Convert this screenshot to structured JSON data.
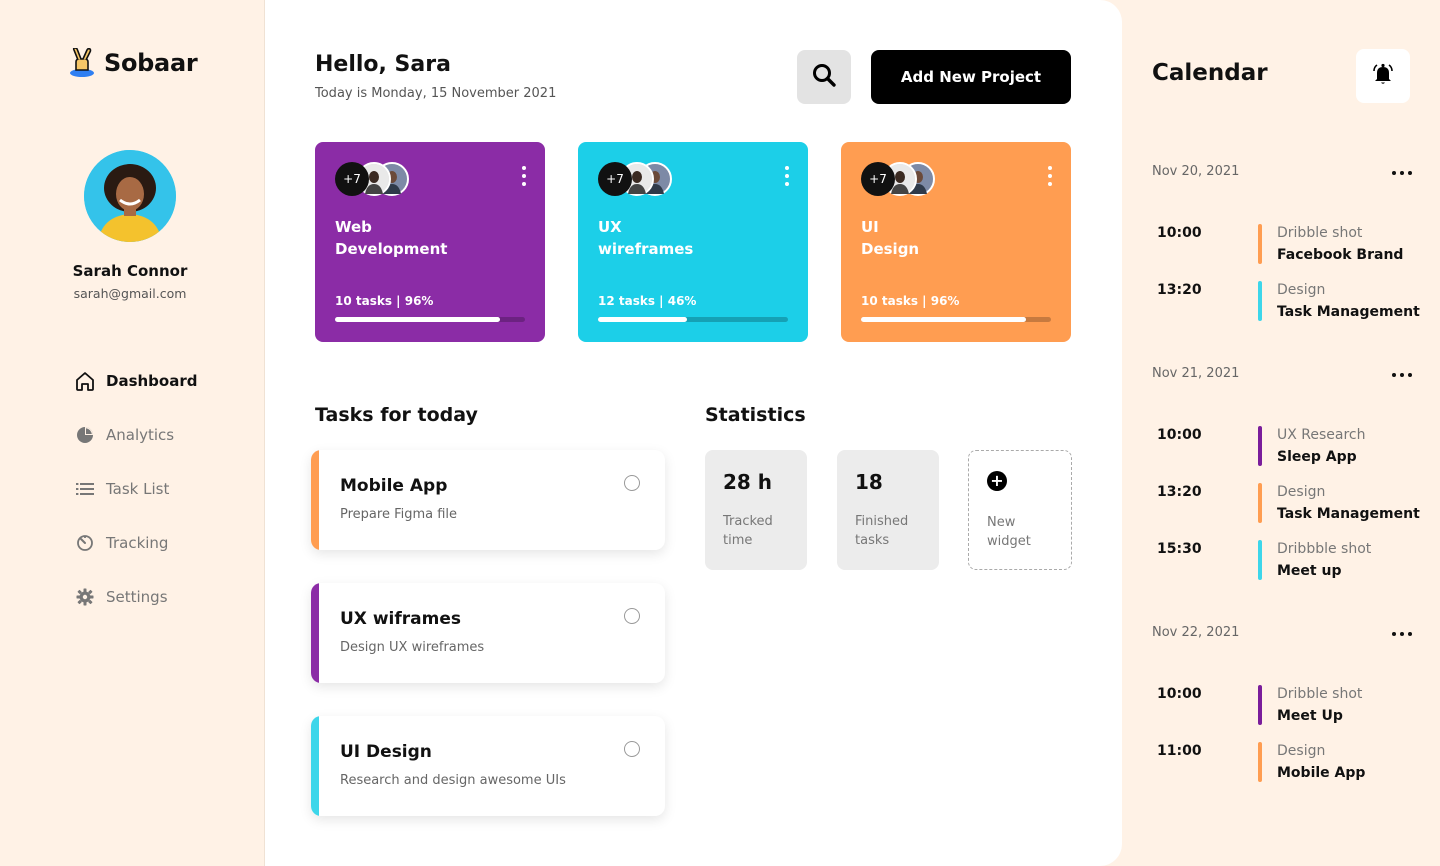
{
  "sidebar": {
    "brand": "Sobaar",
    "profile": {
      "name": "Sarah Connor",
      "email": "sarah@gmail.com"
    },
    "nav": [
      {
        "label": "Dashboard",
        "icon": "home-icon",
        "active": true
      },
      {
        "label": "Analytics",
        "icon": "pie-chart-icon",
        "active": false
      },
      {
        "label": "Task List",
        "icon": "list-icon",
        "active": false
      },
      {
        "label": "Tracking",
        "icon": "timer-icon",
        "active": false
      },
      {
        "label": "Settings",
        "icon": "gear-icon",
        "active": false
      }
    ]
  },
  "header": {
    "greeting": "Hello, Sara",
    "date_line": "Today is Monday, 15 November 2021",
    "add_button": "Add New Project",
    "search_icon": "search-icon"
  },
  "projects": [
    {
      "title_line1": "Web",
      "title_line2": "Development",
      "stats": "10 tasks | 96%",
      "progress": 0.87,
      "members_extra": "+7",
      "color": "#8b2ca6"
    },
    {
      "title_line1": "UX",
      "title_line2": "wireframes",
      "stats": "12 tasks | 46%",
      "progress": 0.47,
      "members_extra": "+7",
      "color": "#1ccfe8"
    },
    {
      "title_line1": "UI",
      "title_line2": "Design",
      "stats": "10 tasks | 96%",
      "progress": 0.87,
      "members_extra": "+7",
      "color": "#ff9d51"
    }
  ],
  "tasks": {
    "title": "Tasks for today",
    "items": [
      {
        "title": "Mobile App",
        "subtitle": "Prepare Figma file",
        "color": "#ff9d51"
      },
      {
        "title": "UX wiframes",
        "subtitle": "Design UX wireframes",
        "color": "#8b2ca6"
      },
      {
        "title": "UI Design",
        "subtitle": "Research and design awesome UIs",
        "color": "#3dd6ea"
      }
    ]
  },
  "statistics": {
    "title": "Statistics",
    "tracked": {
      "value": "28 h",
      "label_line1": "Tracked",
      "label_line2": "time"
    },
    "finished": {
      "value": "18",
      "label_line1": "Finished",
      "label_line2": "tasks"
    },
    "new_widget": {
      "label_line1": "New",
      "label_line2": "widget"
    }
  },
  "calendar": {
    "title": "Calendar",
    "days": [
      {
        "date": "Nov 20, 2021",
        "events": [
          {
            "time": "10:00",
            "category": "Dribble shot",
            "name": "Facebook Brand",
            "color": "#ff9d51"
          },
          {
            "time": "13:20",
            "category": "Design",
            "name": "Task Management",
            "color": "#3dd6ea"
          }
        ]
      },
      {
        "date": "Nov 21, 2021",
        "events": [
          {
            "time": "10:00",
            "category": "UX Research",
            "name": "Sleep App",
            "color": "#7a1d9b"
          },
          {
            "time": "13:20",
            "category": "Design",
            "name": "Task Management",
            "color": "#ff9d51"
          },
          {
            "time": "15:30",
            "category": "Dribbble shot",
            "name": "Meet up",
            "color": "#3dd6ea"
          }
        ]
      },
      {
        "date": "Nov 22, 2021",
        "events": [
          {
            "time": "10:00",
            "category": "Dribble shot",
            "name": "Meet Up",
            "color": "#7a1d9b"
          },
          {
            "time": "11:00",
            "category": "Design",
            "name": "Mobile App",
            "color": "#ff9d51"
          }
        ]
      }
    ]
  }
}
